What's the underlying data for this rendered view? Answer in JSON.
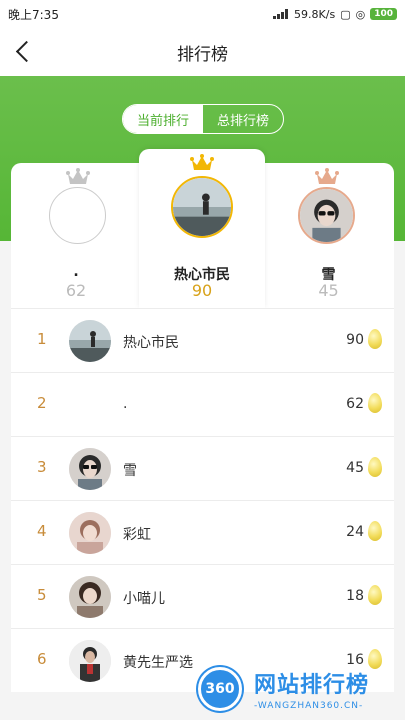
{
  "status_bar": {
    "time": "晚上7:35",
    "speed": "59.8K/s",
    "battery": "100"
  },
  "nav": {
    "title": "排行榜"
  },
  "tabs": [
    {
      "label": "当前排行",
      "active": true
    },
    {
      "label": "总排行榜",
      "active": false
    }
  ],
  "podium": {
    "second": {
      "name": ".",
      "score": "62",
      "crown_color": "#bdbdbd"
    },
    "first": {
      "name": "热心市民",
      "score": "90",
      "crown_color": "#f2b705"
    },
    "third": {
      "name": "雪",
      "score": "45",
      "crown_color": "#e6a98c"
    }
  },
  "ranking": [
    {
      "rank": "1",
      "name": "热心市民",
      "score": "90"
    },
    {
      "rank": "2",
      "name": ".",
      "score": "62"
    },
    {
      "rank": "3",
      "name": "雪",
      "score": "45"
    },
    {
      "rank": "4",
      "name": "彩虹",
      "score": "24"
    },
    {
      "rank": "5",
      "name": "小喵儿",
      "score": "18"
    },
    {
      "rank": "6",
      "name": "黄先生严选",
      "score": "16"
    }
  ],
  "watermark": {
    "logo": "360",
    "title": "网站排行榜",
    "subtitle": "-WANGZHAN360.CN-"
  },
  "colors": {
    "accent_green": "#56b636",
    "rank_orange": "#c88c3a",
    "second_score": "#bbbbbb",
    "first_score": "#d8a21a",
    "third_score": "#bbbbbb"
  }
}
